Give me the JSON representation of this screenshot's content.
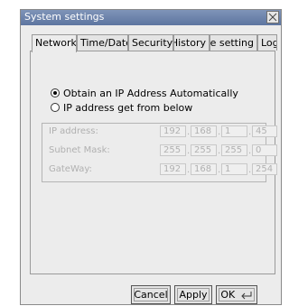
{
  "window": {
    "title": "System settings"
  },
  "tabs": [
    {
      "label": "Network",
      "active": true
    },
    {
      "label": "Time/Date",
      "active": false
    },
    {
      "label": "Security",
      "active": false
    },
    {
      "label": "History",
      "active": false
    },
    {
      "label": "Time setting",
      "active": false
    },
    {
      "label": "Log",
      "active": false
    }
  ],
  "network": {
    "auto_option": "Obtain an IP Address Automatically",
    "manual_option": "IP address get from below",
    "fields": [
      {
        "label": "IP address:",
        "octets": [
          "192",
          "168",
          "1",
          "45"
        ]
      },
      {
        "label": "Subnet Mask:",
        "octets": [
          "255",
          "255",
          "255",
          "0"
        ]
      },
      {
        "label": "GateWay:",
        "octets": [
          "192",
          "168",
          "1",
          "254"
        ]
      }
    ]
  },
  "buttons": {
    "cancel": "Cancel",
    "apply": "Apply",
    "ok": "OK"
  }
}
